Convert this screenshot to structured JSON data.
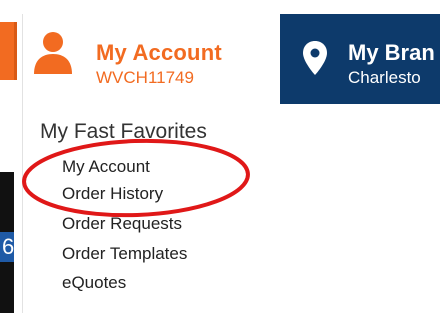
{
  "account": {
    "title": "My Account",
    "account_id": "WVCH11749"
  },
  "branch": {
    "title": "My Bran",
    "location": "Charlesto"
  },
  "favorites": {
    "heading": "My Fast Favorites",
    "items": [
      {
        "label": "My Account"
      },
      {
        "label": "Order History"
      },
      {
        "label": "Order Requests"
      },
      {
        "label": "Order Templates"
      },
      {
        "label": "eQuotes"
      }
    ]
  },
  "side_chip": {
    "text": "6"
  },
  "colors": {
    "accent": "#f26b21",
    "navy": "#0d3a6b",
    "annotation": "#e01818"
  },
  "icons": [
    "person-icon",
    "map-pin-icon"
  ]
}
